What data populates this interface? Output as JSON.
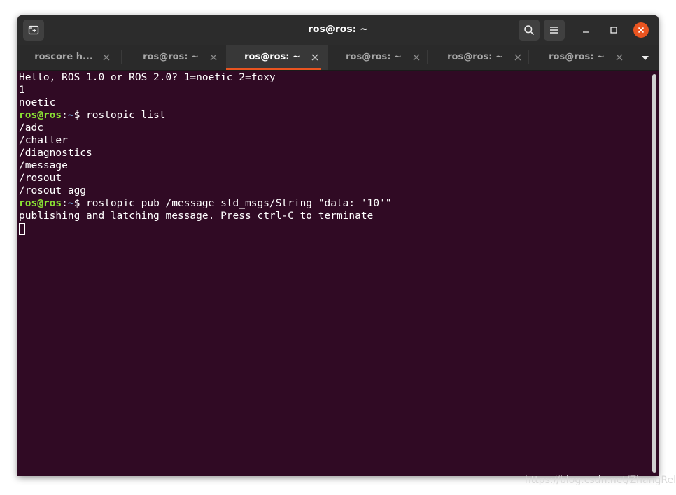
{
  "window": {
    "title": "ros@ros: ~"
  },
  "tabs": [
    {
      "label": "roscore h...",
      "active": false
    },
    {
      "label": "ros@ros: ~",
      "active": false
    },
    {
      "label": "ros@ros: ~",
      "active": true
    },
    {
      "label": "ros@ros: ~",
      "active": false
    },
    {
      "label": "ros@ros: ~",
      "active": false
    },
    {
      "label": "ros@ros: ~",
      "active": false
    }
  ],
  "terminal": {
    "lines": [
      {
        "text": "Hello, ROS 1.0 or ROS 2.0? 1=noetic 2=foxy"
      },
      {
        "text": "1"
      },
      {
        "text": "noetic"
      },
      {
        "prompt_user": "ros@ros",
        "prompt_colon": ":",
        "prompt_path": "~",
        "command": "$ rostopic list"
      },
      {
        "text": "/adc"
      },
      {
        "text": "/chatter"
      },
      {
        "text": "/diagnostics"
      },
      {
        "text": "/message"
      },
      {
        "text": "/rosout"
      },
      {
        "text": "/rosout_agg"
      },
      {
        "prompt_user": "ros@ros",
        "prompt_colon": ":",
        "prompt_path": "~",
        "command": "$ rostopic pub /message std_msgs/String \"data: '10'\""
      },
      {
        "text": "publishing and latching message. Press ctrl-C to terminate"
      }
    ]
  },
  "watermark": "https://blog.csdn.net/ZhangRel",
  "colors": {
    "terminal_bg": "#300a24",
    "prompt_user": "#8ae234",
    "prompt_path": "#729fcf",
    "accent": "#e95420",
    "close_button": "#e95420"
  }
}
